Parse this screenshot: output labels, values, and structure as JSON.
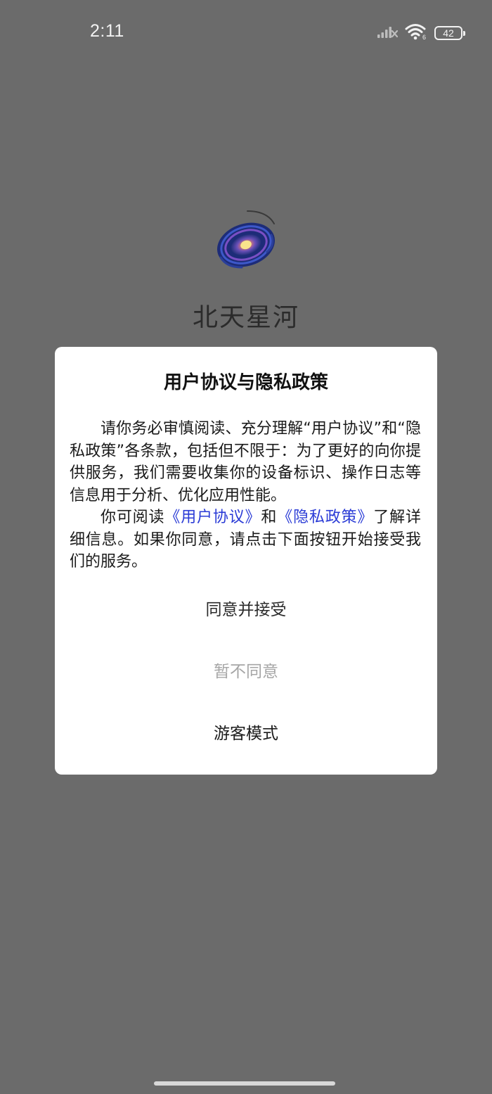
{
  "status_bar": {
    "time": "2:11",
    "battery_level": "42",
    "icons": [
      "signal-icon",
      "wifi-icon",
      "battery-icon"
    ]
  },
  "app": {
    "name": "北天星河",
    "logo_icon": "galaxy-logo-icon"
  },
  "dialog": {
    "title": "用户协议与隐私政策",
    "paragraph1": "请你务必审慎阅读、充分理解“用户协议”和“隐私政策”各条款，包括但不限于：为了更好的向你提供服务，我们需要收集你的设备标识、操作日志等信息用于分析、优化应用性能。",
    "paragraph2_prefix": "你可阅读",
    "user_agreement_link": "《用户协议》",
    "paragraph2_and": "和",
    "privacy_policy_link": "《隐私政策》",
    "paragraph2_suffix": "了解详细信息。如果你同意，请点击下面按钮开始接受我们的服务。",
    "agree_label": "同意并接受",
    "decline_label": "暂不同意",
    "guest_label": "游客模式"
  },
  "colors": {
    "overlay_background": "#6b6b6b",
    "dialog_background": "#ffffff",
    "link": "#2a3bd6",
    "decline_text": "#a6a6a6"
  }
}
